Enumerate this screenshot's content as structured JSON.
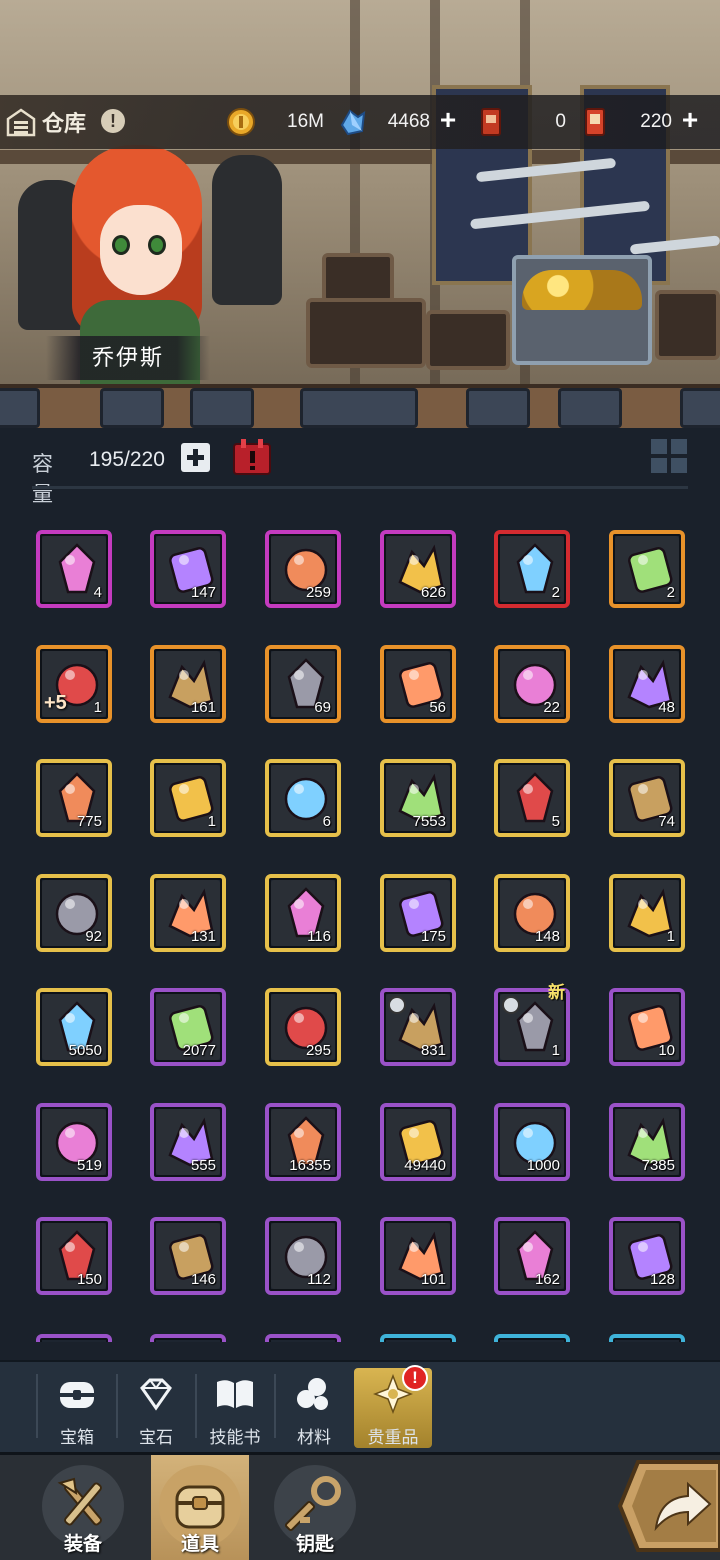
{
  "header": {
    "title": "仓库",
    "info_icon": "info-icon",
    "resources": [
      {
        "icon": "gold-coin-icon",
        "value": "16M"
      },
      {
        "icon": "blue-crystal-icon",
        "value": "4468"
      },
      {
        "icon": "red-ticket-icon",
        "value": "0"
      },
      {
        "icon": "red-card-icon",
        "value": "220"
      }
    ]
  },
  "character": {
    "name": "乔伊斯"
  },
  "capacity": {
    "label": "容量",
    "value": "195/220"
  },
  "items": [
    {
      "icon": "pink-crystal-cluster-icon",
      "count": "4",
      "rarity": "purple"
    },
    {
      "icon": "sword-gem-scroll-icon",
      "count": "147",
      "rarity": "purple"
    },
    {
      "icon": "ring-gem-scroll-icon",
      "count": "259",
      "rarity": "purple"
    },
    {
      "icon": "armor-gem-scroll-icon",
      "count": "626",
      "rarity": "purple"
    },
    {
      "icon": "red-crystal-icon",
      "count": "2",
      "rarity": "red"
    },
    {
      "icon": "green-flute-icon",
      "count": "2",
      "rarity": "orange"
    },
    {
      "icon": "plus5-scroll-icon",
      "count": "1",
      "rarity": "orange",
      "tag": "+5"
    },
    {
      "icon": "winged-cross-icon",
      "count": "161",
      "rarity": "orange"
    },
    {
      "icon": "orange-crystal-icon",
      "count": "69",
      "rarity": "orange"
    },
    {
      "icon": "seed-pouch-icon",
      "count": "56",
      "rarity": "orange"
    },
    {
      "icon": "green-potion-icon",
      "count": "22",
      "rarity": "orange"
    },
    {
      "icon": "hourglass-icon",
      "count": "48",
      "rarity": "orange"
    },
    {
      "icon": "golden-shield-icon",
      "count": "775",
      "rarity": "gold"
    },
    {
      "icon": "golden-key-icon",
      "count": "1",
      "rarity": "gold"
    },
    {
      "icon": "star-shard-icon",
      "count": "6",
      "rarity": "gold"
    },
    {
      "icon": "amber-crystal-icon",
      "count": "7553",
      "rarity": "gold"
    },
    {
      "icon": "paw-cookie-icon",
      "count": "5",
      "rarity": "gold"
    },
    {
      "icon": "parchment-icon",
      "count": "74",
      "rarity": "gold"
    },
    {
      "icon": "bandage-roll-icon",
      "count": "92",
      "rarity": "gold"
    },
    {
      "icon": "red-cloth-icon",
      "count": "131",
      "rarity": "gold"
    },
    {
      "icon": "silver-ingot-icon",
      "count": "116",
      "rarity": "gold"
    },
    {
      "icon": "sealed-envelope-icon",
      "count": "175",
      "rarity": "gold"
    },
    {
      "icon": "gem-pile-icon",
      "count": "148",
      "rarity": "gold"
    },
    {
      "icon": "ice-cube-icon",
      "count": "1",
      "rarity": "gold"
    },
    {
      "icon": "teal-potion-icon",
      "count": "5050",
      "rarity": "gold"
    },
    {
      "icon": "blue-orb-scroll-icon",
      "count": "2077",
      "rarity": "violet"
    },
    {
      "icon": "green-leaf-scroll-icon",
      "count": "295",
      "rarity": "gold"
    },
    {
      "icon": "glowing-sword-icon",
      "count": "831",
      "rarity": "violet",
      "clock": true
    },
    {
      "icon": "red-lantern-icon",
      "count": "1",
      "rarity": "violet",
      "clock": true,
      "new": "新"
    },
    {
      "icon": "blue-map-icon",
      "count": "10",
      "rarity": "violet"
    },
    {
      "icon": "stone-bowl-icon",
      "count": "519",
      "rarity": "violet"
    },
    {
      "icon": "blue-ring-icon",
      "count": "555",
      "rarity": "violet"
    },
    {
      "icon": "purple-shard-icon",
      "count": "16355",
      "rarity": "violet"
    },
    {
      "icon": "violet-crystals-icon",
      "count": "49440",
      "rarity": "violet"
    },
    {
      "icon": "pink-gem-icon",
      "count": "1000",
      "rarity": "violet"
    },
    {
      "icon": "star-jewel-icon",
      "count": "7385",
      "rarity": "violet"
    },
    {
      "icon": "pink-cloth-icon",
      "count": "150",
      "rarity": "violet"
    },
    {
      "icon": "thread-spool-icon",
      "count": "146",
      "rarity": "violet"
    },
    {
      "icon": "red-fabric-icon",
      "count": "112",
      "rarity": "violet"
    },
    {
      "icon": "grey-ore-icon",
      "count": "101",
      "rarity": "violet"
    },
    {
      "icon": "brown-envelope-icon",
      "count": "162",
      "rarity": "violet"
    },
    {
      "icon": "gold-cubes-icon",
      "count": "128",
      "rarity": "violet"
    }
  ],
  "partial_row_rarities": [
    "violet",
    "violet",
    "violet",
    "cyan",
    "cyan",
    "cyan"
  ],
  "categories": [
    {
      "icon": "chest-icon",
      "label": "宝箱"
    },
    {
      "icon": "gem-icon",
      "label": "宝石"
    },
    {
      "icon": "book-icon",
      "label": "技能书"
    },
    {
      "icon": "ore-icon",
      "label": "材料"
    },
    {
      "icon": "star-emblem-icon",
      "label": "贵重品",
      "active": true,
      "alert": "!"
    }
  ],
  "nav": [
    {
      "icon": "sword-axe-icon",
      "label": "装备"
    },
    {
      "icon": "chest-bag-icon",
      "label": "道具",
      "active": true
    },
    {
      "icon": "key-icon",
      "label": "钥匙"
    }
  ],
  "nav_arrow_icon": "forward-arrow-icon",
  "colors": {
    "background": "#1a212b",
    "purple": "#c43bbf",
    "gold": "#e6c04a",
    "orange": "#e8922a",
    "violet": "#9a52c8",
    "active_tab": "#d9b551"
  }
}
